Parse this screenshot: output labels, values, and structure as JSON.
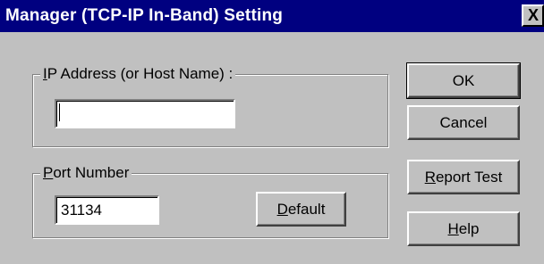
{
  "window": {
    "title": "Manager (TCP-IP In-Band) Setting",
    "close_glyph": "X"
  },
  "ip_group": {
    "label_mnemonic": "I",
    "label_rest": "P Address (or Host Name) :",
    "value": ""
  },
  "port_group": {
    "label_mnemonic": "P",
    "label_rest": "ort Number",
    "value": "31134",
    "default_button_mnemonic": "D",
    "default_button_rest": "efault"
  },
  "buttons": {
    "ok": "OK",
    "cancel": "Cancel",
    "report_test_mnemonic": "R",
    "report_test_rest": "eport Test",
    "help_mnemonic": "H",
    "help_rest": "elp"
  },
  "icons": {
    "close": "close-icon"
  }
}
